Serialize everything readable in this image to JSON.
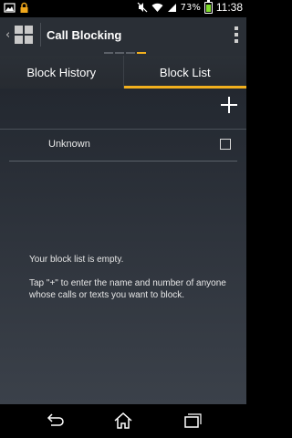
{
  "status_bar": {
    "battery": "73%",
    "battery_level": 0.73,
    "time": "11:38"
  },
  "action_bar": {
    "title": "Call Blocking"
  },
  "tabs": [
    {
      "label": "Block History",
      "active": false
    },
    {
      "label": "Block List",
      "active": true
    }
  ],
  "block_list": {
    "items": [
      {
        "label": "Unknown",
        "checked": false
      }
    ]
  },
  "empty_state": {
    "title": "Your block list is empty.",
    "hint": "Tap \"+\" to enter the name and number of anyone whose calls or texts you want to block."
  },
  "colors": {
    "accent": "#f2b01e",
    "battery_fill": "#7fdc2a"
  }
}
